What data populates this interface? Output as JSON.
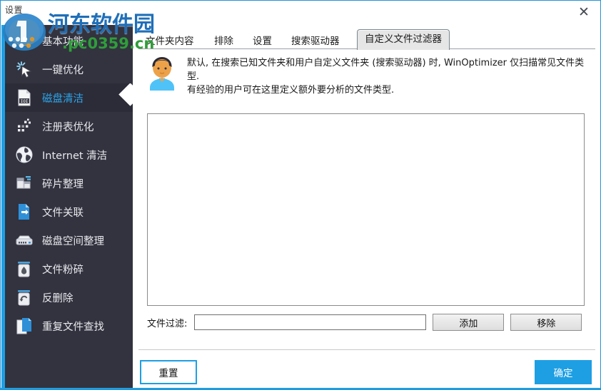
{
  "window": {
    "title": "设置",
    "close_label": "✕",
    "accent_color": "#1e9fe3",
    "sidebar_bg": "#32333f",
    "sidebar_active_bg": "#2b2c38",
    "active_label_color": "#2fa3e8"
  },
  "watermark": {
    "text": "河东软件园",
    "url": ".pc0359.cn",
    "text_color": "#1f6fb8",
    "url_color": "#2f9e3a"
  },
  "sidebar": {
    "items": [
      {
        "label": "基本功能",
        "icon": "dots-grid-icon",
        "active": false
      },
      {
        "label": "一键优化",
        "icon": "cursor-sparkle-icon",
        "active": false
      },
      {
        "label": "磁盘清洁",
        "icon": "document-disk-icon",
        "active": true
      },
      {
        "label": "注册表优化",
        "icon": "registry-dots-icon",
        "active": false
      },
      {
        "label": "Internet 清洁",
        "icon": "globe-icon",
        "active": false
      },
      {
        "label": "碎片整理",
        "icon": "defrag-icon",
        "active": false
      },
      {
        "label": "文件关联",
        "icon": "file-link-icon",
        "active": false
      },
      {
        "label": "磁盘空间整理",
        "icon": "harddisk-icon",
        "active": false
      },
      {
        "label": "文件粉碎",
        "icon": "shredder-icon",
        "active": false
      },
      {
        "label": "反删除",
        "icon": "undelete-icon",
        "active": false
      },
      {
        "label": "重复文件查找",
        "icon": "duplicate-files-icon",
        "active": false
      }
    ]
  },
  "tabs": [
    {
      "label": "文件夹内容",
      "active": false
    },
    {
      "label": "排除",
      "active": false
    },
    {
      "label": "设置",
      "active": false
    },
    {
      "label": "搜索驱动器",
      "active": false
    },
    {
      "label": "自定义文件过滤器",
      "active": true
    }
  ],
  "info": {
    "icon": "user-avatar-icon",
    "line1": "默认, 在搜索已知文件夹和用户自定义文件夹 (搜索驱动器) 时, WinOptimizer 仅扫描常见文件类型.",
    "line2": "有经验的用户可在这里定义额外要分析的文件类型."
  },
  "filter_list": {
    "items": []
  },
  "filter": {
    "label": "文件过滤:",
    "value": "",
    "placeholder": "",
    "add_label": "添加",
    "remove_label": "移除"
  },
  "footer": {
    "reset_label": "重置",
    "ok_label": "确定"
  }
}
